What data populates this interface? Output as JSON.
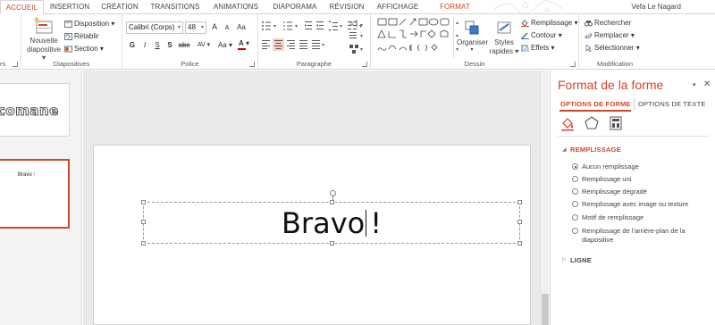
{
  "tabs": {
    "accueil": "ACCUEIL",
    "insertion": "INSERTION",
    "creation": "CRÉATION",
    "transitions": "TRANSITIONS",
    "animations": "ANIMATIONS",
    "diaporama": "DIAPORAMA",
    "revision": "RÉVISION",
    "affichage": "AFFICHAGE",
    "format": "FORMAT"
  },
  "user": {
    "name": "Vefa Le Nagard"
  },
  "ribbon": {
    "diapositives": {
      "label": "Diapositives",
      "nouvelle_line1": "Nouvelle",
      "nouvelle_line2": "diapositive",
      "disposition": "Disposition",
      "retablir": "Rétablir",
      "section": "Section"
    },
    "clipboard_cut_label": "rs",
    "police": {
      "label": "Police",
      "font_name": "Calibri (Corps)",
      "font_size": "48",
      "grow": "A",
      "shrink": "A",
      "clear": "Aa",
      "bold": "G",
      "italic": "I",
      "underline": "S",
      "strike": "S",
      "abc": "abc",
      "spacing": "AV",
      "case": "Aa",
      "font_color": "A"
    },
    "paragraphe": {
      "label": "Paragraphe"
    },
    "dessin": {
      "label": "Dessin",
      "organiser": "Organiser",
      "styles_line1": "Styles",
      "styles_line2": "rapides",
      "remplissage": "Remplissage",
      "contour": "Contour",
      "effets": "Effets"
    },
    "modification": {
      "label": "Modification",
      "rechercher": "Rechercher",
      "remplacer": "Remplacer",
      "selectionner": "Sélectionner"
    }
  },
  "thumbnails": {
    "slide1_text": "comane",
    "slide2_text_main": "Bravo",
    "slide2_text_excl": "!"
  },
  "slide": {
    "text_main": "Bravo",
    "text_excl": "!"
  },
  "pane": {
    "title": "Format de la forme",
    "tab_shape": "OPTIONS DE FORME",
    "tab_text": "OPTIONS DE TEXTE",
    "fill_section": "REMPLISSAGE",
    "fill_options": [
      {
        "label": "Aucun remplissage",
        "checked": true
      },
      {
        "label": "Remplissage uni",
        "checked": false
      },
      {
        "label": "Remplissage dégradé",
        "checked": false
      },
      {
        "label": "Remplissage avec image ou texture",
        "checked": false
      },
      {
        "label": "Motif de remplissage",
        "checked": false
      },
      {
        "label": "Remplissage de l'arrière-plan de la diapositive",
        "checked": false
      }
    ],
    "line_section": "LIGNE"
  },
  "colors": {
    "accent": "#d24726",
    "font_color_bar": "#c00000"
  }
}
